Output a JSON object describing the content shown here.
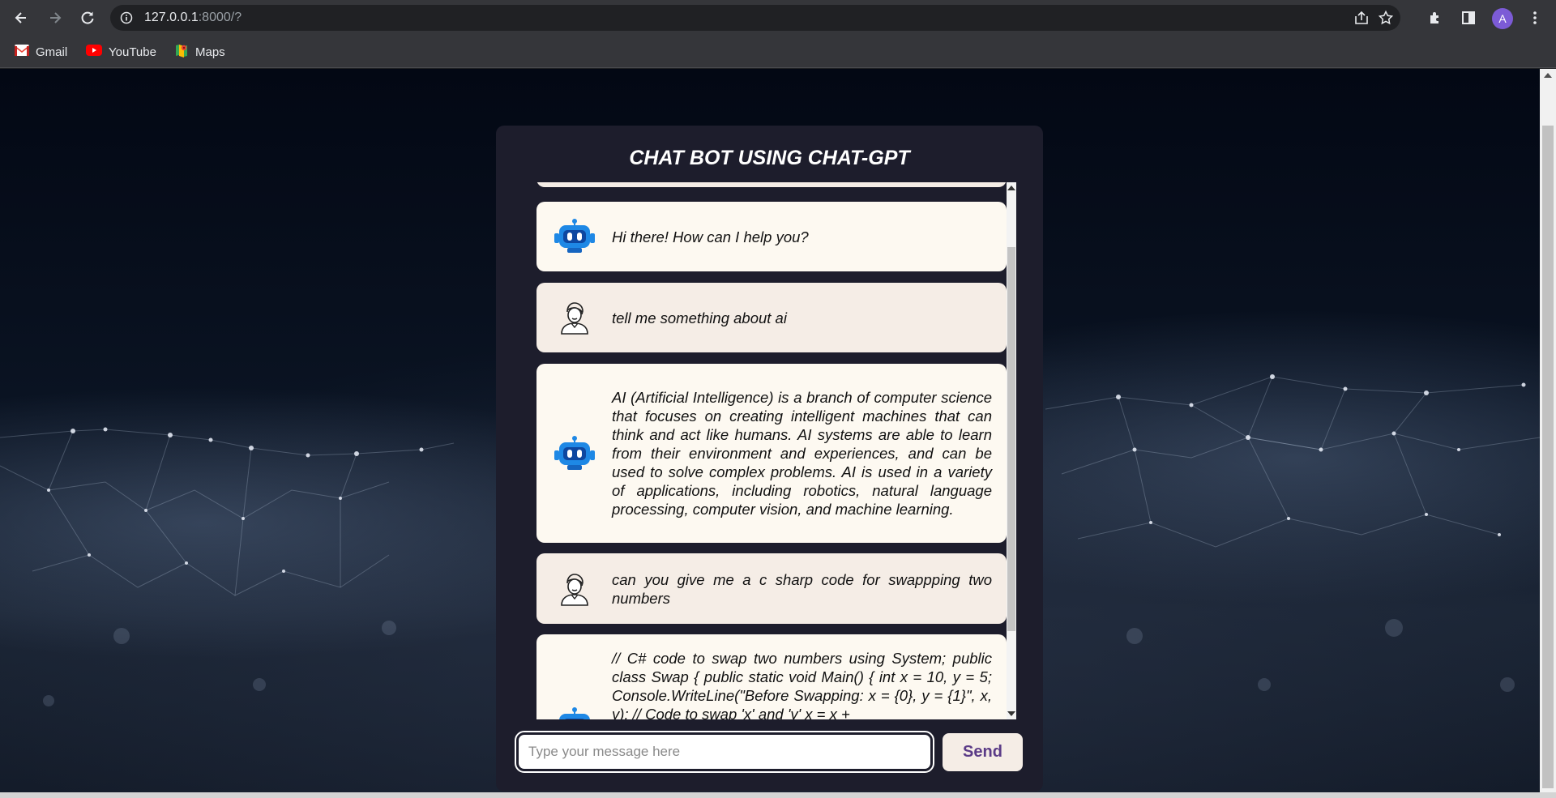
{
  "browser": {
    "url_host": "127.0.0.1",
    "url_path": ":8000/?",
    "avatar_letter": "A",
    "icons": [
      "back-icon",
      "forward-icon",
      "reload-icon",
      "info-icon",
      "share-icon",
      "star-icon",
      "extensions-icon",
      "sidepanel-icon",
      "menu-icon"
    ]
  },
  "bookmarks": [
    {
      "label": "Gmail",
      "icon": "gmail-icon"
    },
    {
      "label": "YouTube",
      "icon": "youtube-icon"
    },
    {
      "label": "Maps",
      "icon": "maps-icon"
    }
  ],
  "chat": {
    "title": "CHAT BOT USING CHAT-GPT",
    "messages": [
      {
        "role": "bot",
        "text": "Hi there! How can I help you?"
      },
      {
        "role": "user",
        "text": "tell me something about ai"
      },
      {
        "role": "bot",
        "text": "AI (Artificial Intelligence) is a branch of computer science that focuses on creating intelligent machines that can think and act like humans. AI systems are able to learn from their environment and experiences, and can be used to solve complex problems. AI is used in a variety of applications, including robotics, natural language processing, computer vision, and machine learning."
      },
      {
        "role": "user",
        "text": "can you give me a c sharp code for swappping two numbers"
      },
      {
        "role": "bot",
        "text": "// C# code to swap two numbers using System; public class Swap { public static void Main() { int x = 10, y = 5; Console.WriteLine(\"Before Swapping: x = {0}, y = {1}\", x, y); // Code to swap 'x' and 'y' x = x +"
      }
    ],
    "input_placeholder": "Type your message here",
    "input_value": "",
    "send_label": "Send"
  },
  "colors": {
    "card": "#1d1d2c",
    "bot_bubble": "#fdf9f1",
    "user_bubble": "#f5ede6",
    "send_text": "#5b3b87",
    "robot_blue": "#1e88e5"
  }
}
